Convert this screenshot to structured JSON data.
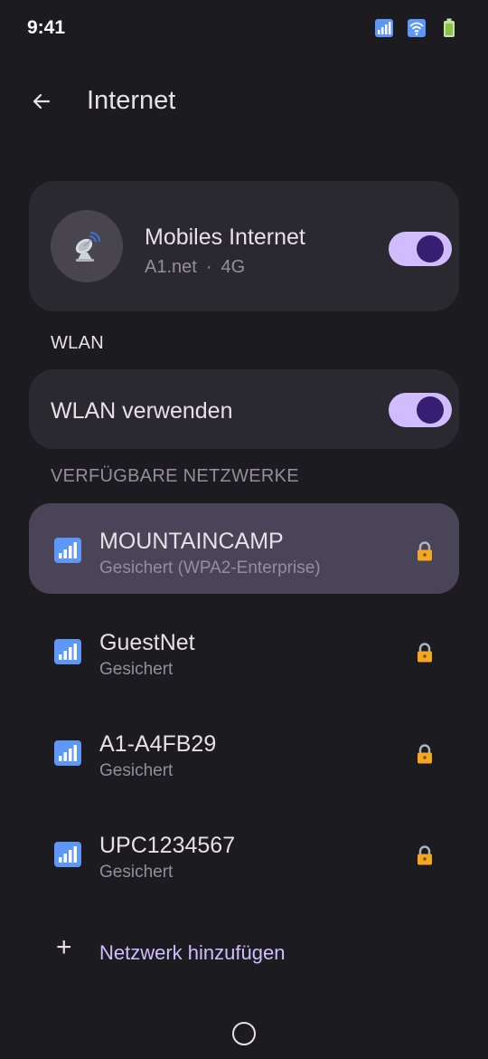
{
  "status_bar": {
    "time": "9:41",
    "icons": [
      "signal-icon",
      "wifi-icon",
      "battery-icon"
    ]
  },
  "app_bar": {
    "back_icon": "arrow-back-icon",
    "title": "Internet"
  },
  "mobile_internet": {
    "icon": "satellite-dish-icon",
    "title": "Mobiles Internet",
    "carrier": "A1.net",
    "separator": "·",
    "network_type": "4G",
    "enabled": true
  },
  "wlan": {
    "section_label": "WLAN",
    "use_label": "WLAN verwenden",
    "enabled": true
  },
  "networks": {
    "section_label": "VERFÜGBARE NETZWERKE",
    "items": [
      {
        "name": "MOUNTAINCAMP",
        "status": "Gesichert (WPA2-Enterprise)",
        "selected": true,
        "secured": true
      },
      {
        "name": "GuestNet",
        "status": "Gesichert",
        "selected": false,
        "secured": true
      },
      {
        "name": "A1-A4FB29",
        "status": "Gesichert",
        "selected": false,
        "secured": true
      },
      {
        "name": "UPC1234567",
        "status": "Gesichert",
        "selected": false,
        "secured": true
      }
    ]
  },
  "add_network": {
    "icon": "+",
    "label": "Netzwerk hinzufügen"
  },
  "colors": {
    "background": "#1c1b1f",
    "card": "#2b2930",
    "selected_row": "#4a4458",
    "accent": "#d0bcff",
    "toggle_thumb": "#381e72",
    "secondary_text": "#938f99"
  }
}
